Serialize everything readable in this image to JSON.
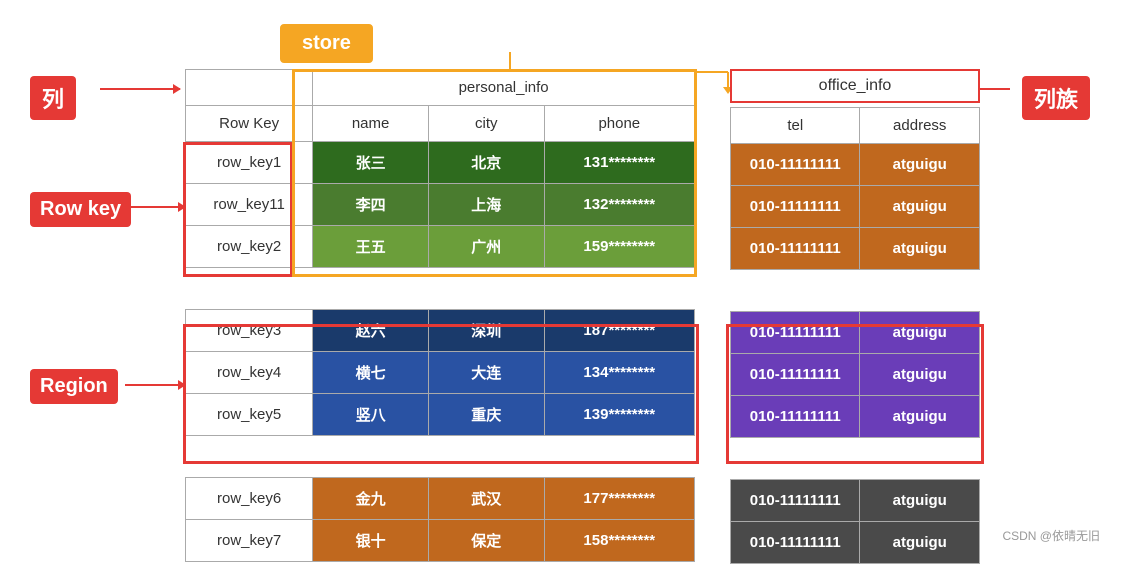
{
  "labels": {
    "lie": "列",
    "liezu": "列族",
    "rowkey": "Row key",
    "region": "Region"
  },
  "store": {
    "label": "store"
  },
  "headers": {
    "personal_info": "personal_info",
    "office_info": "office_info",
    "row_key": "Row Key",
    "name": "name",
    "city": "city",
    "phone": "phone",
    "tel": "tel",
    "address": "address"
  },
  "rows": [
    {
      "key": "row_key1",
      "name": "张三",
      "city": "北京",
      "phone": "131********",
      "tel": "010-11111111",
      "address": "atguigu",
      "group": "rowkey1"
    },
    {
      "key": "row_key11",
      "name": "李四",
      "city": "上海",
      "phone": "132********",
      "tel": "010-11111111",
      "address": "atguigu",
      "group": "rowkey1"
    },
    {
      "key": "row_key2",
      "name": "王五",
      "city": "广州",
      "phone": "159********",
      "tel": "010-11111111",
      "address": "atguigu",
      "group": "rowkey1"
    },
    {
      "key": "row_key3",
      "name": "赵六",
      "city": "深圳",
      "phone": "187********",
      "tel": "010-11111111",
      "address": "atguigu",
      "group": "region1"
    },
    {
      "key": "row_key4",
      "name": "横七",
      "city": "大连",
      "phone": "134********",
      "tel": "010-11111111",
      "address": "atguigu",
      "group": "region1"
    },
    {
      "key": "row_key5",
      "name": "竖八",
      "city": "重庆",
      "phone": "139********",
      "tel": "010-11111111",
      "address": "atguigu",
      "group": "region1"
    },
    {
      "key": "row_key6",
      "name": "金九",
      "city": "武汉",
      "phone": "177********",
      "tel": "010-11111111",
      "address": "atguigu",
      "group": "other"
    },
    {
      "key": "row_key7",
      "name": "银十",
      "city": "保定",
      "phone": "158********",
      "tel": "010-11111111",
      "address": "atguigu",
      "group": "other"
    }
  ],
  "watermark": "CSDN @依晴无旧"
}
